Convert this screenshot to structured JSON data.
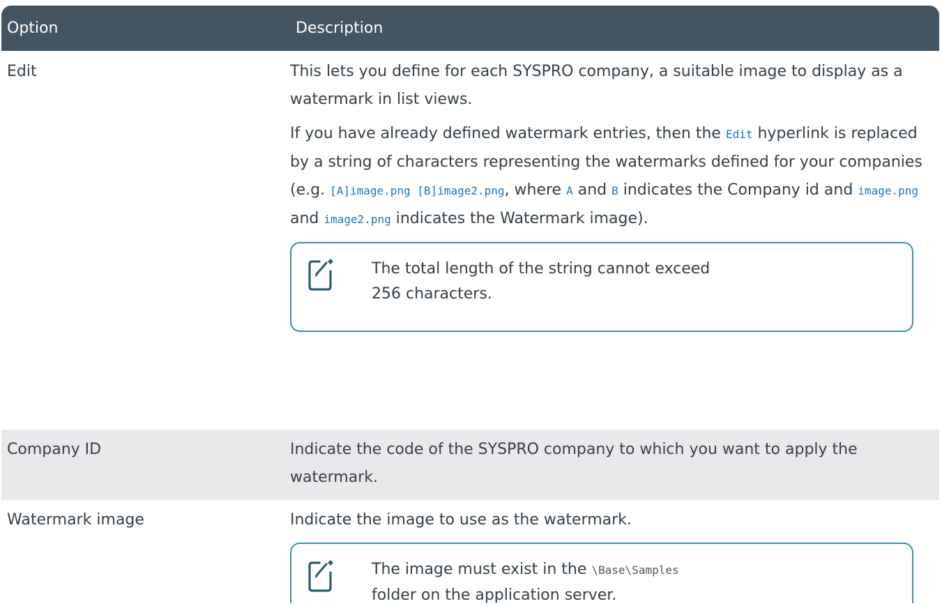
{
  "header": {
    "option": "Option",
    "description": "Description"
  },
  "rows": [
    {
      "option": "Edit",
      "p1": "This lets you define for each SYSPRO company, a suitable image to display as a watermark in list views.",
      "p2": {
        "a": "If you have already defined watermark entries, then the ",
        "code_edit": "Edit",
        "b": " hyperlink is replaced by a string of characters representing the watermarks defined for your companies (e.g. ",
        "code_example": "[A]image.png [B]image2.png",
        "c": ", where ",
        "code_a": "A",
        "d": " and ",
        "code_b": "B",
        "e": " indicates the Company id and ",
        "code_img1": "image.png",
        "f": " and ",
        "code_img2": "image2.png",
        "g": " indicates the Watermark image)."
      },
      "note": "The total length of the string cannot exceed 256 characters."
    },
    {
      "option": "Company ID",
      "description": "Indicate the code of the SYSPRO company to which you want to apply the watermark."
    },
    {
      "option": "Watermark image",
      "description": "Indicate the image to use as the watermark.",
      "note": {
        "a": "The image must exist in the ",
        "code_path": "\\Base\\Samples",
        "b": " folder on the application server."
      }
    }
  ],
  "icons": {
    "note": "note-edit-icon"
  },
  "colors": {
    "header_bg": "#435563",
    "note_border": "#3d8fa8",
    "code": "#1b75bb",
    "shaded_row": "#e9e9eb"
  }
}
